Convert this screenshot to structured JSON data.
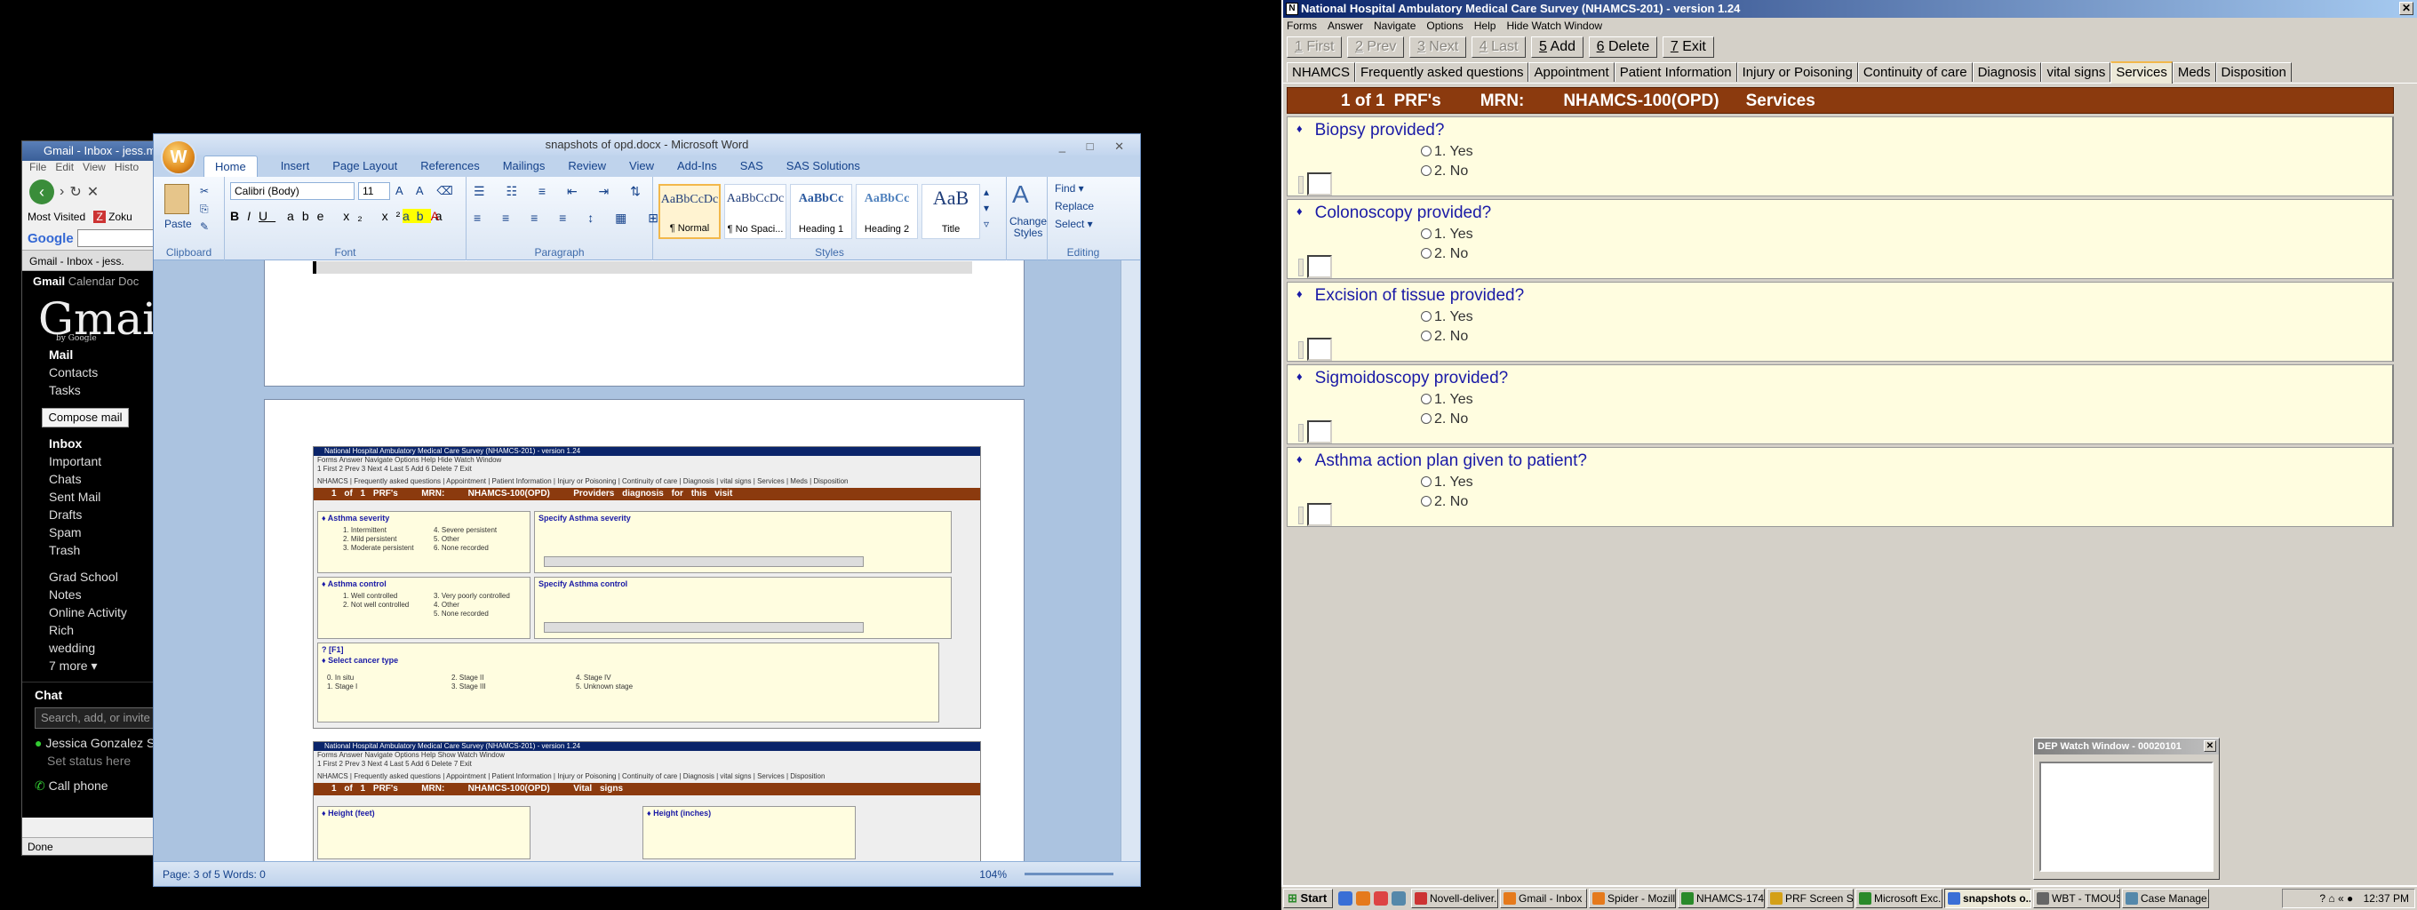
{
  "firefox": {
    "title": "Gmail - Inbox - jess.m",
    "menu": [
      "File",
      "Edit",
      "View",
      "Histo"
    ],
    "bookmarks": [
      "Most Visited",
      "Zoku"
    ],
    "search_label": "Google",
    "tab": "Gmail - Inbox - jess.",
    "status": "Done"
  },
  "gmail": {
    "topnav": [
      "Gmail",
      "Calendar",
      "Doc"
    ],
    "logo": "Gmail",
    "logo_sub": "by Google",
    "nav": [
      "Mail",
      "Contacts",
      "Tasks"
    ],
    "compose": "Compose mail",
    "folders": [
      "Inbox",
      "Important",
      "Chats",
      "Sent Mail",
      "Drafts",
      "Spam",
      "Trash"
    ],
    "labels": [
      "Grad School",
      "Notes",
      "Online Activity",
      "Rich",
      "wedding",
      "7 more ▾"
    ],
    "chat_heading": "Chat",
    "chat_search": "Search, add, or invite",
    "contact": "Jessica Gonzalez S",
    "status_prompt": "Set status here",
    "call": "Call phone"
  },
  "word": {
    "title": "snapshots of opd.docx - Microsoft Word",
    "orb": "W",
    "tabs": [
      "Home",
      "Insert",
      "Page Layout",
      "References",
      "Mailings",
      "Review",
      "View",
      "Add-Ins",
      "SAS",
      "SAS Solutions"
    ],
    "font_name": "Calibri (Body)",
    "font_size": "11",
    "paste": "Paste",
    "groups": [
      "Clipboard",
      "Font",
      "Paragraph",
      "Styles",
      "Editing"
    ],
    "styles": [
      {
        "sample": "AaBbCcDc",
        "name": "¶ Normal"
      },
      {
        "sample": "AaBbCcDc",
        "name": "¶ No Spaci..."
      },
      {
        "sample": "AaBbCc",
        "name": "Heading 1"
      },
      {
        "sample": "AaBbCc",
        "name": "Heading 2"
      },
      {
        "sample": "AaB",
        "name": "Title"
      }
    ],
    "change_styles": "Change Styles",
    "editing": [
      "Find ▾",
      "Replace",
      "Select ▾"
    ],
    "status": "Page: 3 of 5    Words: 0",
    "zoom": "104%"
  },
  "thumb1": {
    "title": "National Hospital Ambulatory Medical Care Survey (NHAMCS-201) - version 1.24",
    "bar": [
      "1 of 1",
      "PRF's",
      "MRN:",
      "NHAMCS-100(OPD)",
      "Providers diagnosis for this visit"
    ],
    "severity_q": "Asthma severity",
    "severity_opts": [
      "1. Intermittent",
      "2. Mild persistent",
      "3. Moderate persistent",
      "4. Severe persistent",
      "5. Other",
      "6. None recorded"
    ],
    "severity_specify": "Specify Asthma severity",
    "control_q": "Asthma control",
    "control_opts": [
      "1. Well controlled",
      "2. Not well controlled",
      "3. Very poorly controlled",
      "4. Other",
      "5. None recorded"
    ],
    "control_specify": "Specify Asthma control",
    "f1": "? [F1]",
    "cancer_q": "Select cancer type",
    "cancer_opts": [
      "0. In situ",
      "1. Stage I",
      "2. Stage II",
      "3. Stage III",
      "4. Stage IV",
      "5. Unknown stage"
    ]
  },
  "thumb2": {
    "title": "National Hospital Ambulatory Medical Care Survey (NHAMCS-201) - version 1.24",
    "bar": [
      "1 of 1",
      "PRF's",
      "MRN:",
      "NHAMCS-100(OPD)",
      "Vital signs"
    ],
    "height_feet": "Height (feet)",
    "height_inches": "Height (inches)"
  },
  "nhamcs": {
    "title": "National Hospital Ambulatory Medical Care Survey (NHAMCS-201) - version 1.24",
    "menu": [
      "Forms",
      "Answer",
      "Navigate",
      "Options",
      "Help",
      "Hide Watch Window"
    ],
    "toolbar": [
      {
        "key": "1",
        "label": " First",
        "disabled": true
      },
      {
        "key": "2",
        "label": " Prev",
        "disabled": true
      },
      {
        "key": "3",
        "label": " Next",
        "disabled": true
      },
      {
        "key": "4",
        "label": " Last",
        "disabled": true
      },
      {
        "key": "5",
        "label": " Add",
        "disabled": false
      },
      {
        "key": "6",
        "label": " Delete",
        "disabled": false
      },
      {
        "key": "7",
        "label": " Exit",
        "disabled": false
      }
    ],
    "tabs": [
      "NHAMCS",
      "Frequently asked questions",
      "Appointment",
      "Patient Information",
      "Injury or Poisoning",
      "Continuity of care",
      "Diagnosis",
      "vital signs",
      "Services",
      "Meds",
      "Disposition"
    ],
    "active_tab": "Services",
    "bar": {
      "record": "1 of 1",
      "prfs": "PRF's",
      "mrn_label": "MRN:",
      "mrn": "NHAMCS-100(OPD)",
      "section": "Services"
    },
    "questions": [
      {
        "label": "Biopsy provided?",
        "options": [
          "1. Yes",
          "2. No"
        ]
      },
      {
        "label": "Colonoscopy provided?",
        "options": [
          "1. Yes",
          "2. No"
        ]
      },
      {
        "label": "Excision of tissue provided?",
        "options": [
          "1. Yes",
          "2. No"
        ]
      },
      {
        "label": "Sigmoidoscopy provided?",
        "options": [
          "1. Yes",
          "2. No"
        ]
      },
      {
        "label": "Asthma action plan given to patient?",
        "options": [
          "1. Yes",
          "2. No"
        ]
      }
    ],
    "diamond": "♦"
  },
  "dep_window": {
    "title": "DEP Watch Window - 00020101"
  },
  "taskbar": {
    "start": "Start",
    "items": [
      "Novell-deliver...",
      "Gmail - Inbox ...",
      "Spider - Mozill...",
      "NHAMCS-174 ...",
      "PRF Screen S...",
      "Microsoft Exc...",
      "snapshots o...",
      "WBT - TMOUS...",
      "Case Manage..."
    ],
    "active": "snapshots o...",
    "clock": "12:37 PM"
  }
}
